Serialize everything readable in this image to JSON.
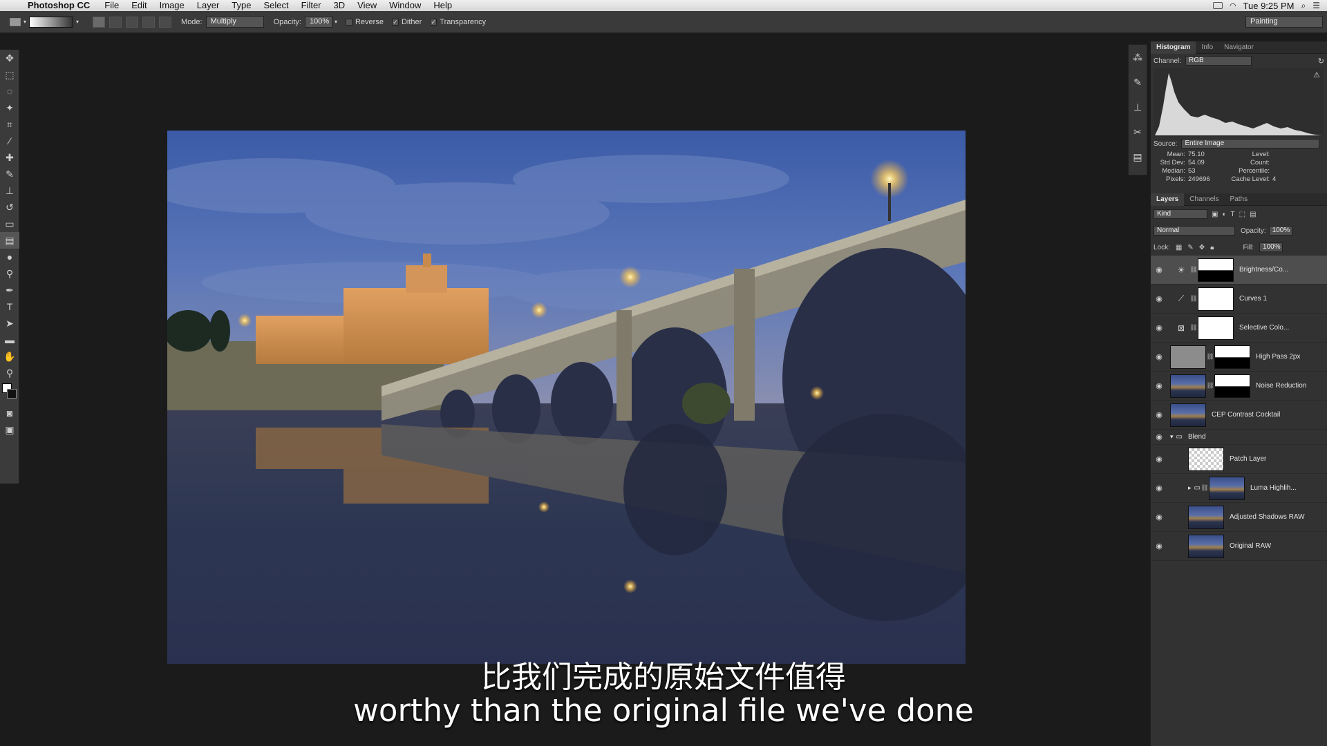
{
  "menubar": {
    "app_name": "Photoshop CC",
    "menus": [
      "File",
      "Edit",
      "Image",
      "Layer",
      "Type",
      "Select",
      "Filter",
      "3D",
      "View",
      "Window",
      "Help"
    ],
    "clock": "Tue 9:25 PM"
  },
  "options": {
    "mode_label": "Mode:",
    "mode_value": "Multiply",
    "opacity_label": "Opacity:",
    "opacity_value": "100%",
    "reverse_label": "Reverse",
    "dither_label": "Dither",
    "transparency_label": "Transparency",
    "workspace": "Painting"
  },
  "histogram": {
    "tabs": [
      "Histogram",
      "Info",
      "Navigator"
    ],
    "channel_label": "Channel:",
    "channel_value": "RGB",
    "source_label": "Source:",
    "source_value": "Entire Image",
    "stats": {
      "mean_label": "Mean:",
      "mean": "75.10",
      "stddev_label": "Std Dev:",
      "stddev": "54.09",
      "median_label": "Median:",
      "median": "53",
      "pixels_label": "Pixels:",
      "pixels": "249696",
      "level_label": "Level:",
      "count_label": "Count:",
      "percentile_label": "Percentile:",
      "cache_label": "Cache Level:",
      "cache": "4"
    }
  },
  "layers": {
    "tabs": [
      "Layers",
      "Channels",
      "Paths"
    ],
    "kind_label": "Kind",
    "blend_mode": "Normal",
    "opacity_label": "Opacity:",
    "opacity_value": "100%",
    "lock_label": "Lock:",
    "fill_label": "Fill:",
    "fill_value": "100%",
    "items": [
      {
        "name": "Brightness/Co...",
        "type": "adjustment",
        "icon": "sun-icon"
      },
      {
        "name": "Curves 1",
        "type": "adjustment",
        "icon": "curves-icon"
      },
      {
        "name": "Selective Colo...",
        "type": "adjustment",
        "icon": "selective-color-icon"
      },
      {
        "name": "High Pass 2px",
        "type": "pixel"
      },
      {
        "name": "Noise Reduction",
        "type": "pixel"
      },
      {
        "name": "CEP Contrast Cocktail",
        "type": "pixel"
      },
      {
        "name": "Blend",
        "type": "group"
      },
      {
        "name": "Patch Layer",
        "type": "pixel"
      },
      {
        "name": "Luma Highlih...",
        "type": "group"
      },
      {
        "name": "Adjusted Shadows RAW",
        "type": "pixel"
      },
      {
        "name": "Original RAW",
        "type": "pixel"
      }
    ]
  },
  "subtitles": {
    "cn": "比我们完成的原始文件值得",
    "en": "worthy than the original file we've done"
  }
}
